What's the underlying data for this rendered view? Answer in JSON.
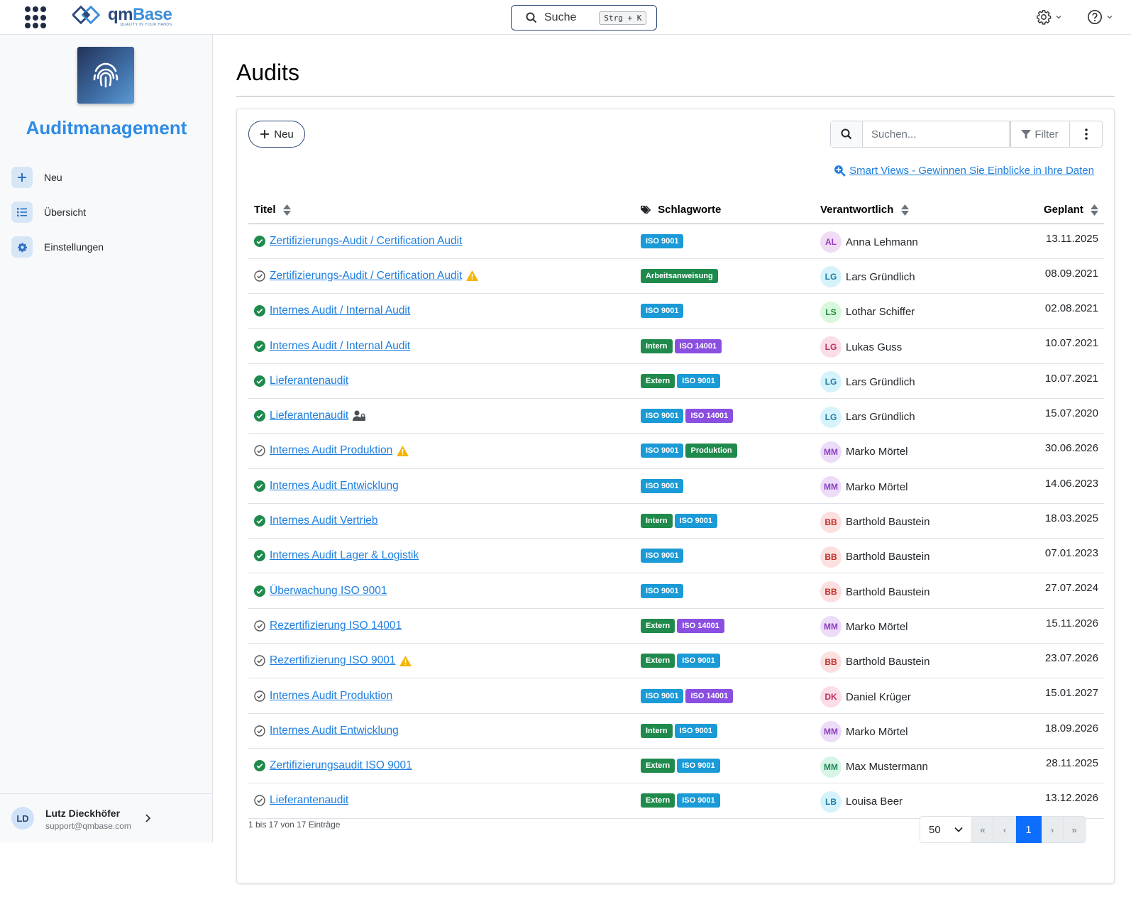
{
  "header": {
    "search_label": "Suche",
    "search_shortcut": "Strg + K",
    "logo_prefix": "qm",
    "logo_suffix": "Base",
    "logo_tagline": "QUALITY IN YOUR HANDS"
  },
  "sidebar": {
    "module_title": "Auditmanagement",
    "items": [
      {
        "label": "Neu",
        "icon": "plus-icon"
      },
      {
        "label": "Übersicht",
        "icon": "list-icon"
      },
      {
        "label": "Einstellungen",
        "icon": "gear-icon"
      }
    ],
    "user": {
      "initials": "LD",
      "name": "Lutz Dieckhöfer",
      "email": "support@qmbase.com"
    }
  },
  "page": {
    "title": "Audits",
    "new_button": "Neu",
    "search_placeholder": "Suchen...",
    "filter_label": "Filter",
    "smart_views": "Smart Views - Gewinnen Sie Einblicke in Ihre Daten"
  },
  "table": {
    "headers": {
      "title": "Titel",
      "tags": "Schlagworte",
      "responsible": "Verantwortlich",
      "planned": "Geplant"
    },
    "rows": [
      {
        "status": "done",
        "title": "Zertifizierungs-Audit / Certification Audit",
        "flag": "",
        "tags": [
          "ISO 9001"
        ],
        "initials": "AL",
        "name": "Anna Lehmann",
        "date": "13.11.2025"
      },
      {
        "status": "open",
        "title": "Zertifizierungs-Audit / Certification Audit",
        "flag": "warning",
        "tags": [
          "Arbeitsanweisung"
        ],
        "initials": "LG",
        "name": "Lars Gründlich",
        "date": "08.09.2021"
      },
      {
        "status": "done",
        "title": "Internes Audit / Internal Audit",
        "flag": "",
        "tags": [
          "ISO 9001"
        ],
        "initials": "LS",
        "name": "Lothar Schiffer",
        "date": "02.08.2021"
      },
      {
        "status": "done",
        "title": "Internes Audit / Internal Audit",
        "flag": "",
        "tags": [
          "Intern",
          "ISO 14001"
        ],
        "initials": "LG",
        "name": "Lukas Guss",
        "date": "10.07.2021"
      },
      {
        "status": "done",
        "title": "Lieferantenaudit",
        "flag": "",
        "tags": [
          "Extern",
          "ISO 9001"
        ],
        "initials": "LG",
        "name": "Lars Gründlich",
        "date": "10.07.2021"
      },
      {
        "status": "done",
        "title": "Lieferantenaudit",
        "flag": "restricted",
        "tags": [
          "ISO 9001",
          "ISO 14001"
        ],
        "initials": "LG",
        "name": "Lars Gründlich",
        "date": "15.07.2020"
      },
      {
        "status": "open",
        "title": "Internes Audit Produktion",
        "flag": "warning",
        "tags": [
          "ISO 9001",
          "Produktion"
        ],
        "initials": "MM",
        "name": "Marko Mörtel",
        "date": "30.06.2026"
      },
      {
        "status": "done",
        "title": "Internes Audit Entwicklung",
        "flag": "",
        "tags": [
          "ISO 9001"
        ],
        "initials": "MM",
        "name": "Marko Mörtel",
        "date": "14.06.2023"
      },
      {
        "status": "done",
        "title": "Internes Audit Vertrieb",
        "flag": "",
        "tags": [
          "Intern",
          "ISO 9001"
        ],
        "initials": "BB",
        "name": "Barthold Baustein",
        "date": "18.03.2025"
      },
      {
        "status": "done",
        "title": "Internes Audit Lager & Logistik",
        "flag": "",
        "tags": [
          "ISO 9001"
        ],
        "initials": "BB",
        "name": "Barthold Baustein",
        "date": "07.01.2023"
      },
      {
        "status": "done",
        "title": "Überwachung ISO 9001",
        "flag": "",
        "tags": [
          "ISO 9001"
        ],
        "initials": "BB",
        "name": "Barthold Baustein",
        "date": "27.07.2024"
      },
      {
        "status": "open",
        "title": "Rezertifizierung ISO 14001",
        "flag": "",
        "tags": [
          "Extern",
          "ISO 14001"
        ],
        "initials": "MM",
        "name": "Marko Mörtel",
        "date": "15.11.2026"
      },
      {
        "status": "open",
        "title": "Rezertifizierung ISO 9001",
        "flag": "warning",
        "tags": [
          "Extern",
          "ISO 9001"
        ],
        "initials": "BB",
        "name": "Barthold Baustein",
        "date": "23.07.2026"
      },
      {
        "status": "open",
        "title": "Internes Audit Produktion",
        "flag": "",
        "tags": [
          "ISO 9001",
          "ISO 14001"
        ],
        "initials": "DK",
        "name": "Daniel Krüger",
        "date": "15.01.2027"
      },
      {
        "status": "open",
        "title": "Internes Audit Entwicklung",
        "flag": "",
        "tags": [
          "Intern",
          "ISO 9001"
        ],
        "initials": "MM",
        "name": "Marko Mörtel",
        "date": "18.09.2026"
      },
      {
        "status": "done",
        "title": "Zertifizierungsaudit ISO 9001",
        "flag": "",
        "tags": [
          "Extern",
          "ISO 9001"
        ],
        "initials": "MM",
        "name": "Max Mustermann",
        "date": "28.11.2025"
      },
      {
        "status": "open",
        "title": "Lieferantenaudit",
        "flag": "",
        "tags": [
          "Extern",
          "ISO 9001"
        ],
        "initials": "LB",
        "name": "Louisa Beer",
        "date": "13.12.2026"
      }
    ]
  },
  "footer": {
    "info": "1 bis 17 von 17 Einträge",
    "page_size": "50",
    "pages": [
      "«",
      "‹",
      "1",
      "›",
      "»"
    ],
    "current_page": "1"
  },
  "colors": {
    "tags": {
      "ISO 9001": "#1a9ad6",
      "ISO 14001": "#8a4fe0",
      "Intern": "#1f8a4c",
      "Extern": "#1f8a4c",
      "Arbeitsanweisung": "#1f8a4c",
      "Produktion": "#1f8a4c"
    },
    "avatars": {
      "AL": [
        "#f0dcf5",
        "#9c3cbf"
      ],
      "LG": [
        "#d6f3fb",
        "#1b7ea3"
      ],
      "LS": [
        "#d9f7dc",
        "#1f8a3b"
      ],
      "LG2": [
        "#fbdde7",
        "#c0305e"
      ],
      "MM": [
        "#eddcf8",
        "#8a3fc2"
      ],
      "BB": [
        "#fbe0df",
        "#c2302a"
      ],
      "DK": [
        "#fbdde7",
        "#c0305e"
      ],
      "MM2": [
        "#d7f5e6",
        "#1d8a55"
      ],
      "LB": [
        "#d6f3fb",
        "#1b7ea3"
      ]
    }
  }
}
